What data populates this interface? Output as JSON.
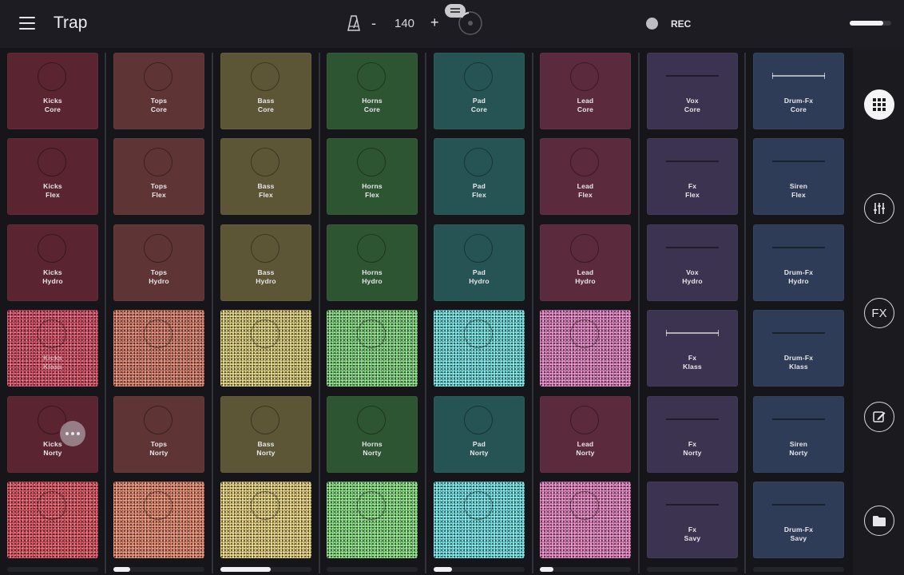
{
  "app": {
    "title": "Trap"
  },
  "header": {
    "tempo_minus": "-",
    "tempo_value": "140",
    "tempo_plus": "+",
    "rec_label": "REC",
    "master_volume_level": 0.8
  },
  "sidebar": {
    "items": [
      {
        "icon": "grid-icon",
        "active": true
      },
      {
        "icon": "mixer-icon",
        "active": false
      },
      {
        "icon": "fx-icon",
        "label": "FX",
        "active": false
      },
      {
        "icon": "edit-icon",
        "active": false
      },
      {
        "icon": "folder-icon",
        "active": false
      }
    ]
  },
  "columns": [
    {
      "pads": [
        {
          "name": "Kicks",
          "variant": "Core",
          "style": "circle"
        },
        {
          "name": "Kicks",
          "variant": "Flex",
          "style": "circle"
        },
        {
          "name": "Kicks",
          "variant": "Hydro",
          "style": "circle"
        },
        {
          "name": "Kicks",
          "variant": "Klass",
          "style": "circle",
          "state": "active"
        },
        {
          "name": "Kicks",
          "variant": "Norty",
          "style": "circle"
        },
        {
          "name": "",
          "variant": "",
          "style": "circle",
          "state": "playing"
        }
      ],
      "level": 0
    },
    {
      "pads": [
        {
          "name": "Tops",
          "variant": "Core",
          "style": "circle"
        },
        {
          "name": "Tops",
          "variant": "Flex",
          "style": "circle"
        },
        {
          "name": "Tops",
          "variant": "Hydro",
          "style": "circle"
        },
        {
          "name": "",
          "variant": "",
          "style": "circle",
          "state": "active"
        },
        {
          "name": "Tops",
          "variant": "Norty",
          "style": "circle"
        },
        {
          "name": "",
          "variant": "",
          "style": "circle",
          "state": "playing"
        }
      ],
      "level": 0.18
    },
    {
      "pads": [
        {
          "name": "Bass",
          "variant": "Core",
          "style": "circle"
        },
        {
          "name": "Bass",
          "variant": "Flex",
          "style": "circle"
        },
        {
          "name": "Bass",
          "variant": "Hydro",
          "style": "circle"
        },
        {
          "name": "",
          "variant": "",
          "style": "circle",
          "state": "active"
        },
        {
          "name": "Bass",
          "variant": "Norty",
          "style": "circle"
        },
        {
          "name": "",
          "variant": "",
          "style": "circle",
          "state": "playing"
        }
      ],
      "level": 0.55
    },
    {
      "pads": [
        {
          "name": "Horns",
          "variant": "Core",
          "style": "circle"
        },
        {
          "name": "Horns",
          "variant": "Flex",
          "style": "circle"
        },
        {
          "name": "Horns",
          "variant": "Hydro",
          "style": "circle"
        },
        {
          "name": "",
          "variant": "",
          "style": "circle",
          "state": "active"
        },
        {
          "name": "Horns",
          "variant": "Norty",
          "style": "circle"
        },
        {
          "name": "",
          "variant": "",
          "style": "circle",
          "state": "playing"
        }
      ],
      "level": 0
    },
    {
      "pads": [
        {
          "name": "Pad",
          "variant": "Core",
          "style": "circle"
        },
        {
          "name": "Pad",
          "variant": "Flex",
          "style": "circle"
        },
        {
          "name": "Pad",
          "variant": "Hydro",
          "style": "circle"
        },
        {
          "name": "",
          "variant": "",
          "style": "circle",
          "state": "active"
        },
        {
          "name": "Pad",
          "variant": "Norty",
          "style": "circle"
        },
        {
          "name": "",
          "variant": "",
          "style": "circle",
          "state": "playing"
        }
      ],
      "level": 0.2
    },
    {
      "pads": [
        {
          "name": "Lead",
          "variant": "Core",
          "style": "circle"
        },
        {
          "name": "Lead",
          "variant": "Flex",
          "style": "circle"
        },
        {
          "name": "Lead",
          "variant": "Hydro",
          "style": "circle"
        },
        {
          "name": "",
          "variant": "",
          "style": "circle",
          "state": "active"
        },
        {
          "name": "Lead",
          "variant": "Norty",
          "style": "circle"
        },
        {
          "name": "",
          "variant": "",
          "style": "circle",
          "state": "playing"
        }
      ],
      "level": 0.15
    },
    {
      "pads": [
        {
          "name": "Vox",
          "variant": "Core",
          "style": "line"
        },
        {
          "name": "Fx",
          "variant": "Flex",
          "style": "line"
        },
        {
          "name": "Vox",
          "variant": "Hydro",
          "style": "line"
        },
        {
          "name": "Fx",
          "variant": "Klass",
          "style": "line-white"
        },
        {
          "name": "Fx",
          "variant": "Norty",
          "style": "line"
        },
        {
          "name": "Fx",
          "variant": "Savy",
          "style": "line"
        }
      ],
      "level": 0
    },
    {
      "pads": [
        {
          "name": "Drum-Fx",
          "variant": "Core",
          "style": "line-white"
        },
        {
          "name": "Siren",
          "variant": "Flex",
          "style": "line"
        },
        {
          "name": "Drum-Fx",
          "variant": "Hydro",
          "style": "line"
        },
        {
          "name": "Drum-Fx",
          "variant": "Klass",
          "style": "line"
        },
        {
          "name": "Siren",
          "variant": "Norty",
          "style": "line"
        },
        {
          "name": "Drum-Fx",
          "variant": "Savy",
          "style": "line"
        }
      ],
      "level": 0
    }
  ],
  "colors": {
    "columns": [
      {
        "normal": "#5a2430",
        "active": "#e85a72",
        "playing": "#f0606e"
      },
      {
        "normal": "#5e3434",
        "active": "#e88a76",
        "playing": "#f6967a"
      },
      {
        "normal": "#5d5636",
        "active": "#eadc86",
        "playing": "#f5e08a"
      },
      {
        "normal": "#2e5532",
        "active": "#8fe78d",
        "playing": "#94f08e"
      },
      {
        "normal": "#265454",
        "active": "#7ff0f0",
        "playing": "#7ef2f4"
      },
      {
        "normal": "#5b2a3c",
        "active": "#f08ed0",
        "playing": "#f590cf"
      },
      {
        "normal": "#3c3350",
        "active": "#3c3350",
        "playing": "#3c3350"
      },
      {
        "normal": "#2e3c58",
        "active": "#2e3c58",
        "playing": "#2e3c58"
      }
    ]
  }
}
